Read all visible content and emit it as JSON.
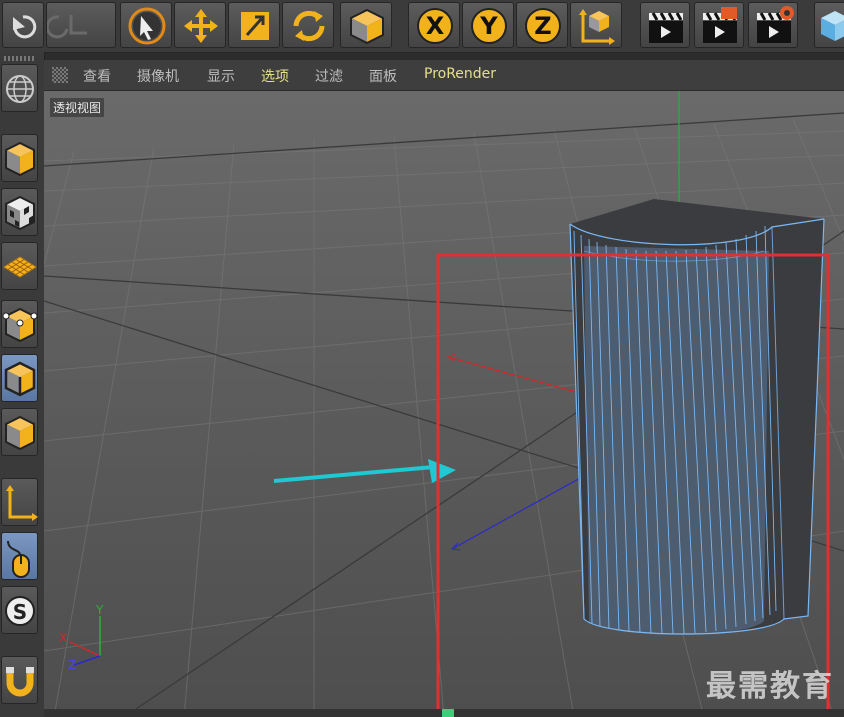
{
  "toolbar": {
    "buttons": [
      {
        "name": "undo-button",
        "icon": "undo-icon"
      },
      {
        "name": "redo-button",
        "icon": "redo-icon"
      },
      {
        "name": "live-select-button",
        "icon": "arrow-cursor-icon"
      },
      {
        "name": "move-button",
        "icon": "move-arrows-icon"
      },
      {
        "name": "scale-button",
        "icon": "scale-icon"
      },
      {
        "name": "rotate-button",
        "icon": "rotate-icon"
      },
      {
        "name": "last-tool-button",
        "icon": "cube-icon"
      },
      {
        "name": "x-axis-lock-button",
        "icon": "x-axis-icon",
        "label": "X"
      },
      {
        "name": "y-axis-lock-button",
        "icon": "y-axis-icon",
        "label": "Y"
      },
      {
        "name": "z-axis-lock-button",
        "icon": "z-axis-icon",
        "label": "Z"
      },
      {
        "name": "coordinate-system-button",
        "icon": "world-coordinates-icon"
      },
      {
        "name": "render-view-button",
        "icon": "clapper-icon"
      },
      {
        "name": "render-picture-viewer-button",
        "icon": "clapper-icon"
      },
      {
        "name": "render-settings-button",
        "icon": "clapper-gear-icon"
      },
      {
        "name": "cube-object-button",
        "icon": "cube-icon"
      }
    ]
  },
  "sidebar": {
    "buttons": [
      {
        "name": "make-editable-button",
        "icon": "globe-mesh-icon"
      },
      {
        "name": "model-mode-button",
        "icon": "cube-icon"
      },
      {
        "name": "texture-mode-button",
        "icon": "checker-cube-icon"
      },
      {
        "name": "workplane-mode-button",
        "icon": "grid-plane-icon"
      },
      {
        "name": "point-mode-button",
        "icon": "cube-points-icon"
      },
      {
        "name": "edge-mode-button",
        "icon": "cube-edges-icon"
      },
      {
        "name": "polygon-mode-button",
        "icon": "cube-polygons-icon"
      },
      {
        "name": "axis-mode-button",
        "icon": "axis-icon"
      },
      {
        "name": "tweak-mode-button",
        "icon": "mouse-icon"
      },
      {
        "name": "snap-button",
        "icon": "s-icon"
      },
      {
        "name": "magnet-button",
        "icon": "magnet-icon"
      }
    ]
  },
  "menubar": {
    "items": [
      "查看",
      "摄像机",
      "显示",
      "选项",
      "过滤",
      "面板",
      "ProRender"
    ],
    "highlighted": [
      "选项",
      "ProRender"
    ]
  },
  "viewport": {
    "label": "透视视图",
    "axis_labels": {
      "x": "X",
      "y": "Y",
      "z": "Z"
    },
    "watermark": "最需教育",
    "colors": {
      "x_axis": "#cc2a2a",
      "y_axis": "#2fae3a",
      "z_axis": "#2a2ac8",
      "highlight_box": "#e03030",
      "annotation_arrow": "#1fc8d2",
      "wireframe": "#7ab7f2",
      "object_face": "#3a3c40"
    }
  }
}
